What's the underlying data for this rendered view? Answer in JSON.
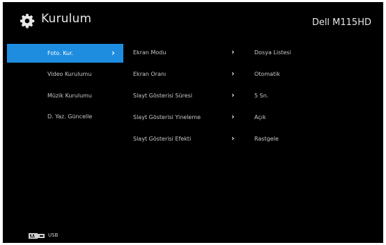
{
  "header": {
    "title": "Kurulum",
    "model": "Dell M115HD",
    "icon": "gear-icon"
  },
  "sidebar": {
    "items": [
      {
        "label": "Foto. Kur.",
        "active": true
      },
      {
        "label": "Video Kurulumu",
        "active": false
      },
      {
        "label": "Müzik Kurulumu",
        "active": false
      },
      {
        "label": "D. Yaz. Güncelle",
        "active": false
      }
    ],
    "active_color": "#1e8de0"
  },
  "settings": [
    {
      "name": "Ekran Modu",
      "value": "Dosya Listesi"
    },
    {
      "name": "Ekran Oranı",
      "value": "Otomatik"
    },
    {
      "name": "Slayt Gösterisi Süresi",
      "value": "5 Sn."
    },
    {
      "name": "Slayt Gösterisi Yineleme",
      "value": "Açık"
    },
    {
      "name": "Slayt Gösterisi Efekti",
      "value": "Rastgele"
    }
  ],
  "footer": {
    "source_label": "USB",
    "icon": "usb-icon"
  }
}
